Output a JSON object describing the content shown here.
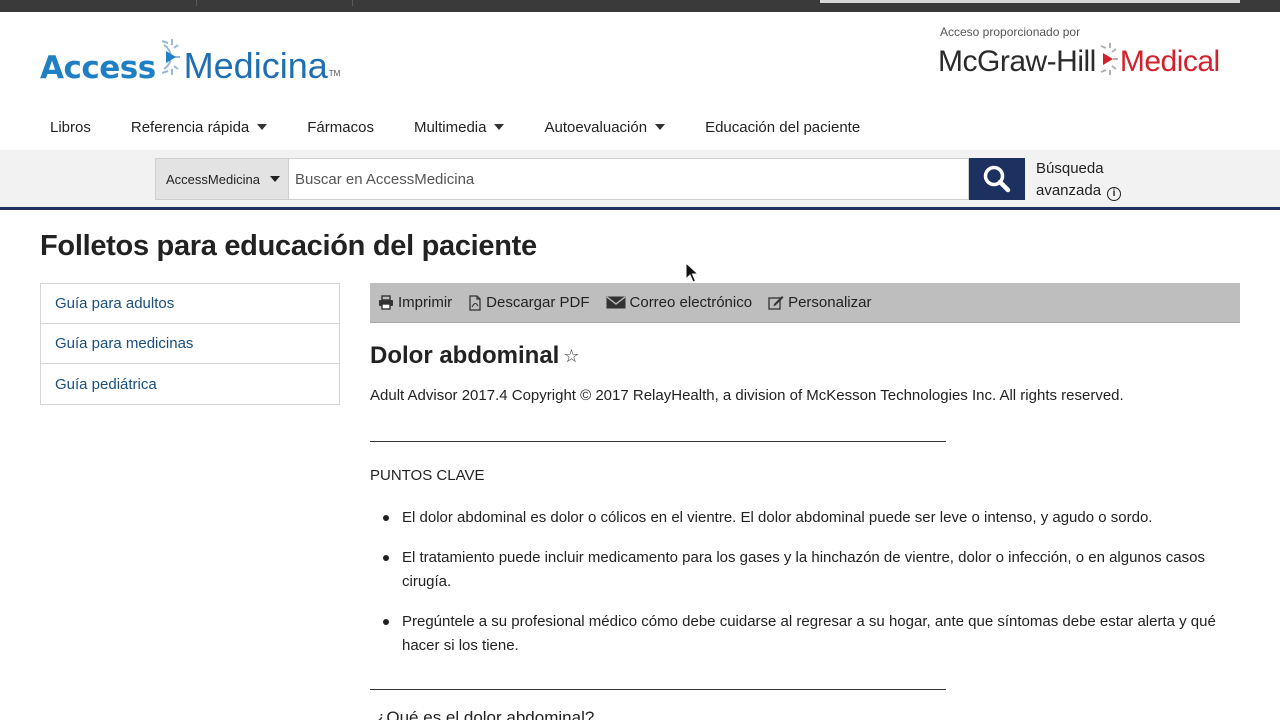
{
  "logo": {
    "access": "Access",
    "medicina": "Medicina",
    "tm": "TM"
  },
  "sponsor": {
    "provided_by": "Acceso proporcionado por",
    "name": "McGraw-Hill",
    "division": "Medical"
  },
  "nav": [
    {
      "label": "Libros",
      "dropdown": false
    },
    {
      "label": "Referencia rápida",
      "dropdown": true
    },
    {
      "label": "Fármacos",
      "dropdown": false
    },
    {
      "label": "Multimedia",
      "dropdown": true
    },
    {
      "label": "Autoevaluación",
      "dropdown": true
    },
    {
      "label": "Educación del paciente",
      "dropdown": false
    }
  ],
  "search": {
    "scope": "AccessMedicina",
    "placeholder": "Buscar en AccessMedicina",
    "advanced_line1": "Búsqueda",
    "advanced_line2": "avanzada"
  },
  "page": {
    "title": "Folletos para educación del paciente"
  },
  "sidebar": [
    {
      "label": "Guía para adultos"
    },
    {
      "label": "Guía para medicinas"
    },
    {
      "label": "Guía pediátrica"
    }
  ],
  "toolbar": [
    {
      "label": "Imprimir",
      "icon": "printer-icon"
    },
    {
      "label": "Descargar PDF",
      "icon": "pdf-icon"
    },
    {
      "label": "Correo electrónico",
      "icon": "envelope-icon"
    },
    {
      "label": "Personalizar",
      "icon": "edit-icon"
    }
  ],
  "article": {
    "title": "Dolor abdominal",
    "copyright": "Adult Advisor 2017.4 Copyright © 2017 RelayHealth, a division of McKesson Technologies Inc. All rights reserved.",
    "section_head": "PUNTOS CLAVE",
    "bullets": [
      "El dolor abdominal es dolor o cólicos en el vientre. El dolor abdominal puede ser leve o intenso, y agudo o sordo.",
      "El tratamiento puede incluir medicamento para los gases y la hinchazón de vientre, dolor o infección, o en algunos casos cirugía.",
      "Pregúntele a su profesional médico cómo debe cuidarse al regresar a su hogar, ante que síntomas debe estar alerta y qué hacer si los tiene."
    ],
    "next_head": "¿Qué es el dolor abdominal?"
  },
  "colors": {
    "brand_blue": "#1f7fc4",
    "navy": "#1d3161",
    "mh_red": "#d3202c",
    "link": "#1a4f7a"
  }
}
